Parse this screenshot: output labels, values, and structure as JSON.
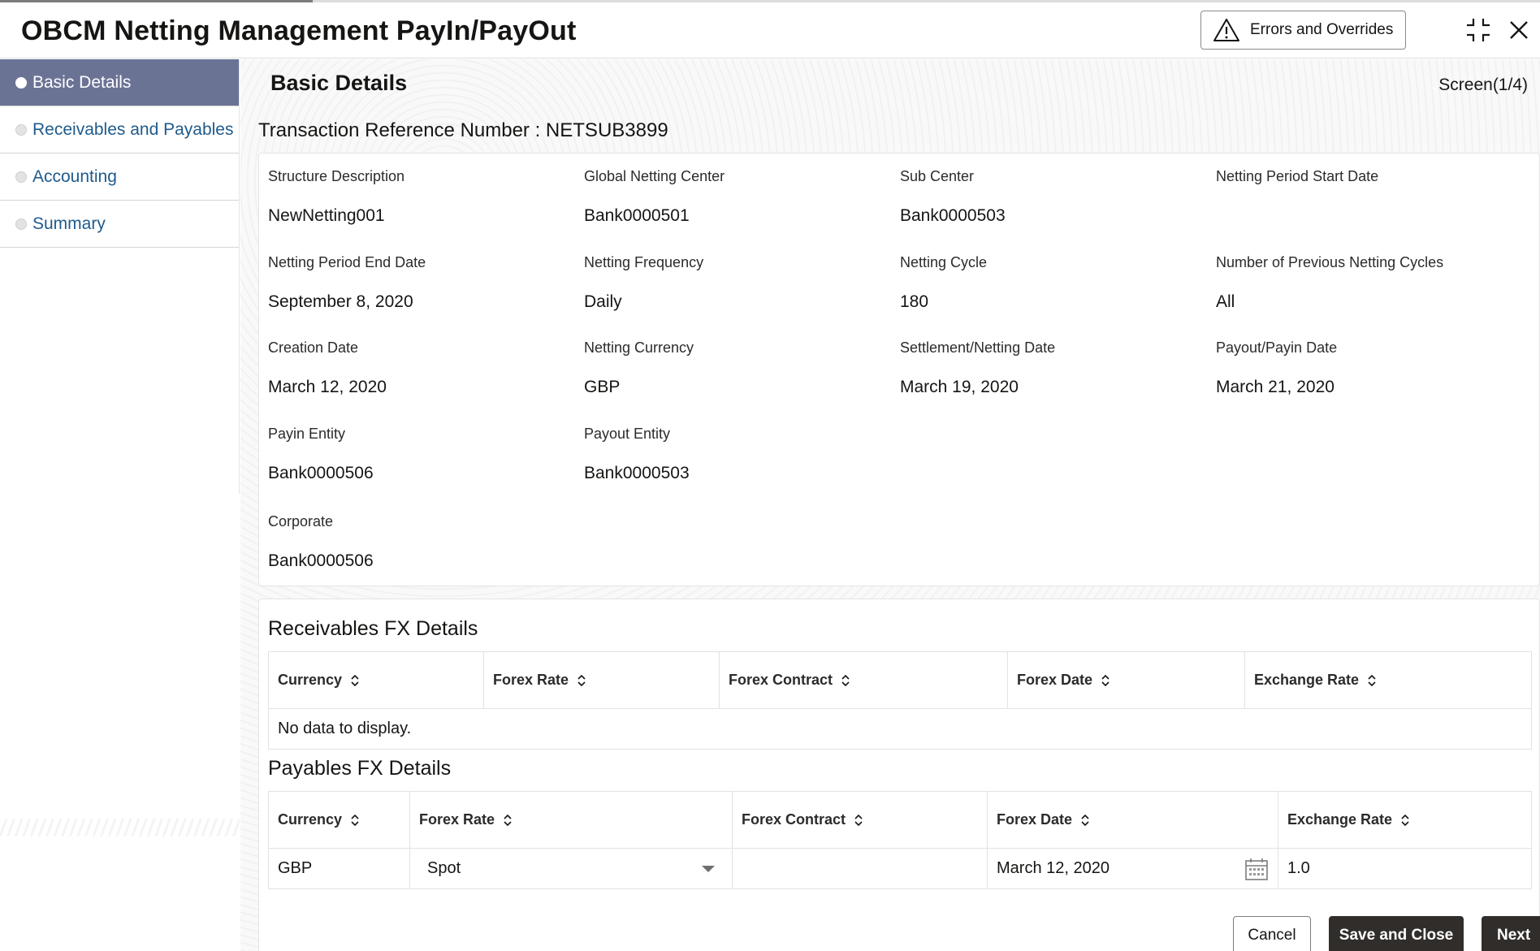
{
  "header": {
    "title": "OBCM Netting Management PayIn/PayOut",
    "errors_button": "Errors and Overrides"
  },
  "sidebar": {
    "items": [
      {
        "label": "Basic Details",
        "active": true
      },
      {
        "label": "Receivables and Payables",
        "active": false
      },
      {
        "label": "Accounting",
        "active": false
      },
      {
        "label": "Summary",
        "active": false
      }
    ]
  },
  "main": {
    "section_title": "Basic Details",
    "screen_indicator": "Screen(1/4)",
    "transaction_reference": "Transaction Reference Number : NETSUB3899",
    "fields": [
      {
        "label": "Structure Description",
        "value": "NewNetting001"
      },
      {
        "label": "Global Netting Center",
        "value": "Bank0000501"
      },
      {
        "label": "Sub Center",
        "value": "Bank0000503"
      },
      {
        "label": "Netting Period Start Date",
        "value": ""
      },
      {
        "label": "Netting Period End Date",
        "value": "September 8, 2020"
      },
      {
        "label": "Netting Frequency",
        "value": "Daily"
      },
      {
        "label": "Netting Cycle",
        "value": "180"
      },
      {
        "label": "Number of Previous Netting Cycles",
        "value": "All"
      },
      {
        "label": "Creation Date",
        "value": "March 12, 2020"
      },
      {
        "label": "Netting Currency",
        "value": "GBP"
      },
      {
        "label": "Settlement/Netting Date",
        "value": "March 19, 2020"
      },
      {
        "label": "Payout/Payin Date",
        "value": "March 21, 2020"
      },
      {
        "label": "Payin Entity",
        "value": "Bank0000506"
      },
      {
        "label": "Payout Entity",
        "value": "Bank0000503"
      },
      {
        "label": "Corporate",
        "value": "Bank0000506"
      }
    ]
  },
  "receivables_fx": {
    "title": "Receivables FX Details",
    "columns": [
      "Currency",
      "Forex Rate",
      "Forex Contract",
      "Forex Date",
      "Exchange Rate"
    ],
    "empty_text": "No data to display."
  },
  "payables_fx": {
    "title": "Payables FX Details",
    "columns": [
      "Currency",
      "Forex Rate",
      "Forex Contract",
      "Forex Date",
      "Exchange Rate"
    ],
    "rows": [
      {
        "currency": "GBP",
        "forex_rate": "Spot",
        "forex_contract": "",
        "forex_date": "March 12, 2020",
        "exchange_rate": "1.0"
      }
    ]
  },
  "footer": {
    "cancel": "Cancel",
    "save_close": "Save and Close",
    "next": "Next"
  }
}
